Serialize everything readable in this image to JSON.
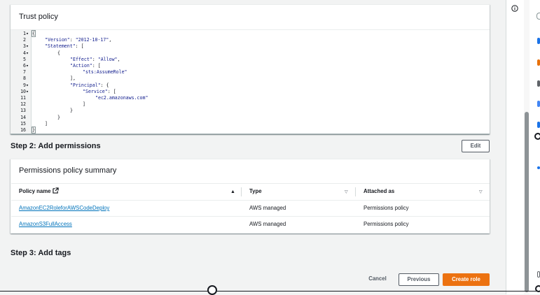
{
  "trust_policy": {
    "title": "Trust policy",
    "line_numbers": [
      "1",
      "2",
      "3",
      "4",
      "5",
      "6",
      "7",
      "8",
      "9",
      "10",
      "11",
      "12",
      "13",
      "14",
      "15",
      "16"
    ],
    "fold_markers": [
      "1",
      "3",
      "4",
      "6",
      "9",
      "10"
    ],
    "code": {
      "l1": "{",
      "l2_key": "\"Version\"",
      "l2_val": "\"2012-10-17\"",
      "l3_key": "\"Statement\"",
      "l3_rest": ": [",
      "l4": "{",
      "l5_key": "\"Effect\"",
      "l5_val": "\"Allow\"",
      "l6_key": "\"Action\"",
      "l6_rest": ": [",
      "l7_val": "\"sts:AssumeRole\"",
      "l8": "],",
      "l9_key": "\"Principal\"",
      "l9_rest": ": {",
      "l10_key": "\"Service\"",
      "l10_rest": ": [",
      "l11_val": "\"ec2.amazonaws.com\"",
      "l12": "]",
      "l13": "}",
      "l14": "}",
      "l15": "]",
      "l16": "}"
    }
  },
  "step2": {
    "title": "Step 2: Add permissions",
    "edit_label": "Edit",
    "summary_title": "Permissions policy summary",
    "columns": {
      "policy_name": "Policy name",
      "type": "Type",
      "attached_as": "Attached as"
    },
    "rows": [
      {
        "policy_name": "AmazonEC2RoleforAWSCodeDeploy",
        "type": "AWS managed",
        "attached_as": "Permissions policy"
      },
      {
        "policy_name": "AmazonS3FullAccess",
        "type": "AWS managed",
        "attached_as": "Permissions policy"
      }
    ]
  },
  "step3": {
    "title": "Step 3: Add tags"
  },
  "footer": {
    "cancel_label": "Cancel",
    "previous_label": "Previous",
    "create_label": "Create role"
  },
  "colors": {
    "primary": "#ec7211",
    "link": "#0073bb"
  }
}
